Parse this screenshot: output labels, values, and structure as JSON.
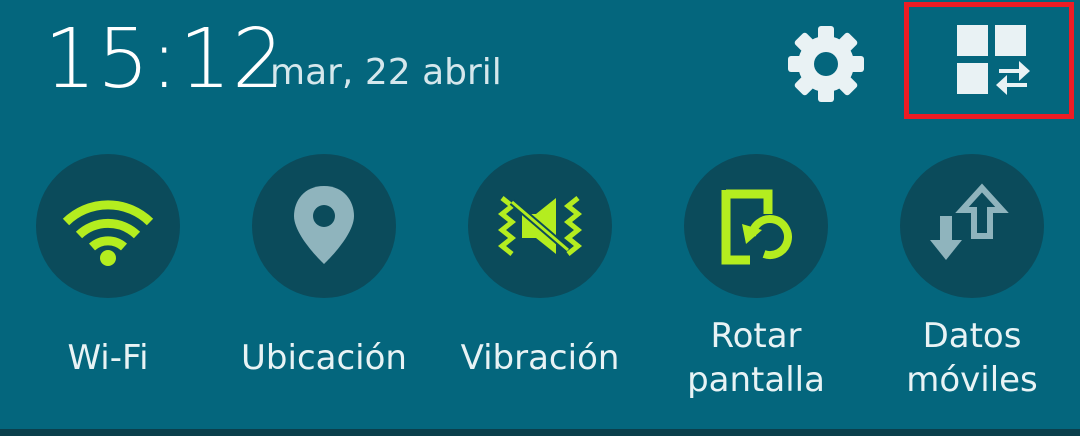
{
  "status": {
    "time": "15:12",
    "date": "mar, 22 abril"
  },
  "header": {
    "settings_icon": "gear-icon",
    "edit_icon": "quick-settings-edit-icon",
    "highlight_color": "#ec1c24"
  },
  "colors": {
    "panel_bg": "#04667d",
    "tile_bg": "#0b4b5b",
    "active_icon": "#b4ed1f",
    "inactive_icon": "#8fb4bd",
    "label_text": "#e8f3f5"
  },
  "tiles": [
    {
      "label": "Wi-Fi",
      "icon": "wifi-icon",
      "active": true
    },
    {
      "label": "Ubicación",
      "icon": "location-pin-icon",
      "active": false
    },
    {
      "label": "Vibración",
      "icon": "vibration-icon",
      "active": true
    },
    {
      "label_line1": "Rotar",
      "label_line2": "pantalla",
      "icon": "rotate-screen-icon",
      "active": true
    },
    {
      "label_line1": "Datos",
      "label_line2": "móviles",
      "icon": "mobile-data-icon",
      "active": false
    }
  ]
}
